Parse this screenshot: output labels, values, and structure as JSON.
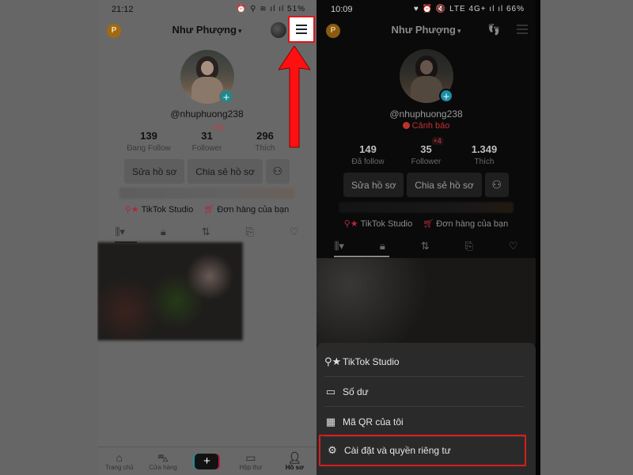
{
  "left_screen": {
    "status_bar": {
      "time": "21:12",
      "icons": "⏰ ⚲ ≋ ıl ıl",
      "battery": "51%"
    },
    "header": {
      "coin_badge": "P",
      "title": "Như Phượng",
      "menu_icon": "hamburger-menu-icon"
    },
    "profile": {
      "handle": "@nhuphuong238",
      "stats": [
        {
          "value": "139",
          "label": "Đang Follow"
        },
        {
          "value": "31",
          "label": "Follower",
          "delta": "+4"
        },
        {
          "value": "296",
          "label": "Thích"
        }
      ],
      "buttons": {
        "edit": "Sửa hồ sơ",
        "share": "Chia sẻ hồ sơ"
      },
      "links": {
        "studio": "TikTok Studio",
        "orders": "Đơn hàng của bạn"
      }
    },
    "tabs": [
      "videos-grid",
      "private",
      "reposts",
      "favorites",
      "liked"
    ],
    "bottom_nav": [
      {
        "label": "Trang chủ",
        "icon": "⌂"
      },
      {
        "label": "Cửa hàng",
        "icon": "🛍"
      },
      {
        "label": "",
        "icon": "+"
      },
      {
        "label": "Hộp thư",
        "icon": "✉"
      },
      {
        "label": "Hồ sơ",
        "icon": "●"
      }
    ]
  },
  "right_screen": {
    "status_bar": {
      "time": "10:09",
      "icons": "♥ ⏰ 🔇 LTE 4G+ ıl ıl",
      "battery": "66%"
    },
    "header": {
      "coin_badge": "P",
      "title": "Như Phượng"
    },
    "profile": {
      "handle": "@nhuphuong238",
      "warning": "Cảnh báo",
      "stats": [
        {
          "value": "149",
          "label": "Đã follow"
        },
        {
          "value": "35",
          "label": "Follower",
          "delta": "+4"
        },
        {
          "value": "1.349",
          "label": "Thích"
        }
      ],
      "buttons": {
        "edit": "Sửa hồ sơ",
        "share": "Chia sẻ hồ sơ"
      },
      "links": {
        "studio": "TikTok Studio",
        "orders": "Đơn hàng của bạn"
      }
    },
    "sheet_menu": [
      {
        "label": "TikTok Studio",
        "icon": "user-star"
      },
      {
        "label": "Số dư",
        "icon": "wallet"
      },
      {
        "label": "Mã QR của tôi",
        "icon": "qr-code"
      },
      {
        "label": "Cài đặt và quyền riêng tư",
        "icon": "gear",
        "highlighted": true
      }
    ]
  },
  "annotation": {
    "highlight_color": "#e01818"
  }
}
